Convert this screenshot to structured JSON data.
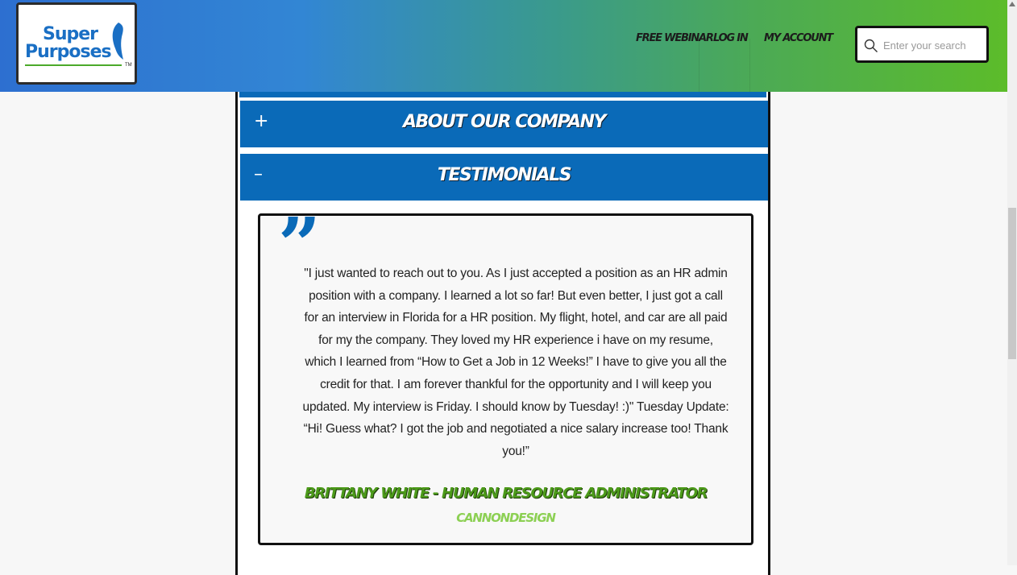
{
  "logo": {
    "line1": "Super",
    "line2": "Purposes",
    "tm": "TM"
  },
  "nav": {
    "items": [
      {
        "label": "FREE WEBINAR"
      },
      {
        "label": "LOG IN"
      },
      {
        "label": "MY ACCOUNT"
      }
    ]
  },
  "search": {
    "placeholder": "Enter your search",
    "value": ""
  },
  "accordion": {
    "sections": [
      {
        "toggle": "+",
        "title": "ABOUT OUR COMPANY",
        "expanded": false
      },
      {
        "toggle": "–",
        "title": "TESTIMONIALS",
        "expanded": true
      }
    ]
  },
  "testimonial": {
    "quote_mark": "”",
    "text": "\"I just wanted to reach out to you. As I just accepted a position as an HR admin position with a company. I learned a lot so far! But even better, I just got a call for an interview in Florida for a HR position. My flight, hotel, and car are all paid for my the company. They loved my HR experience i have on my resume, which I learned from “How to Get a Job in 12 Weeks!” I have to give you all the credit for that. I am forever thankful for the opportunity and I will keep you updated. My interview is Friday. I should know by Tuesday! :)\" Tuesday Update: “Hi! Guess what? I got the job and negotiated a nice salary increase too! Thank you!”",
    "author": "BRITTANY WHITE - HUMAN RESOURCE ADMINISTRATOR",
    "company": "CANNONDESIGN"
  },
  "colors": {
    "header_gradient_start": "#2d6fd0",
    "header_gradient_end": "#5cbc2a",
    "accordion_bg": "#0a6ab8",
    "author_green": "#4c9a1a",
    "company_green": "#8cd053"
  }
}
